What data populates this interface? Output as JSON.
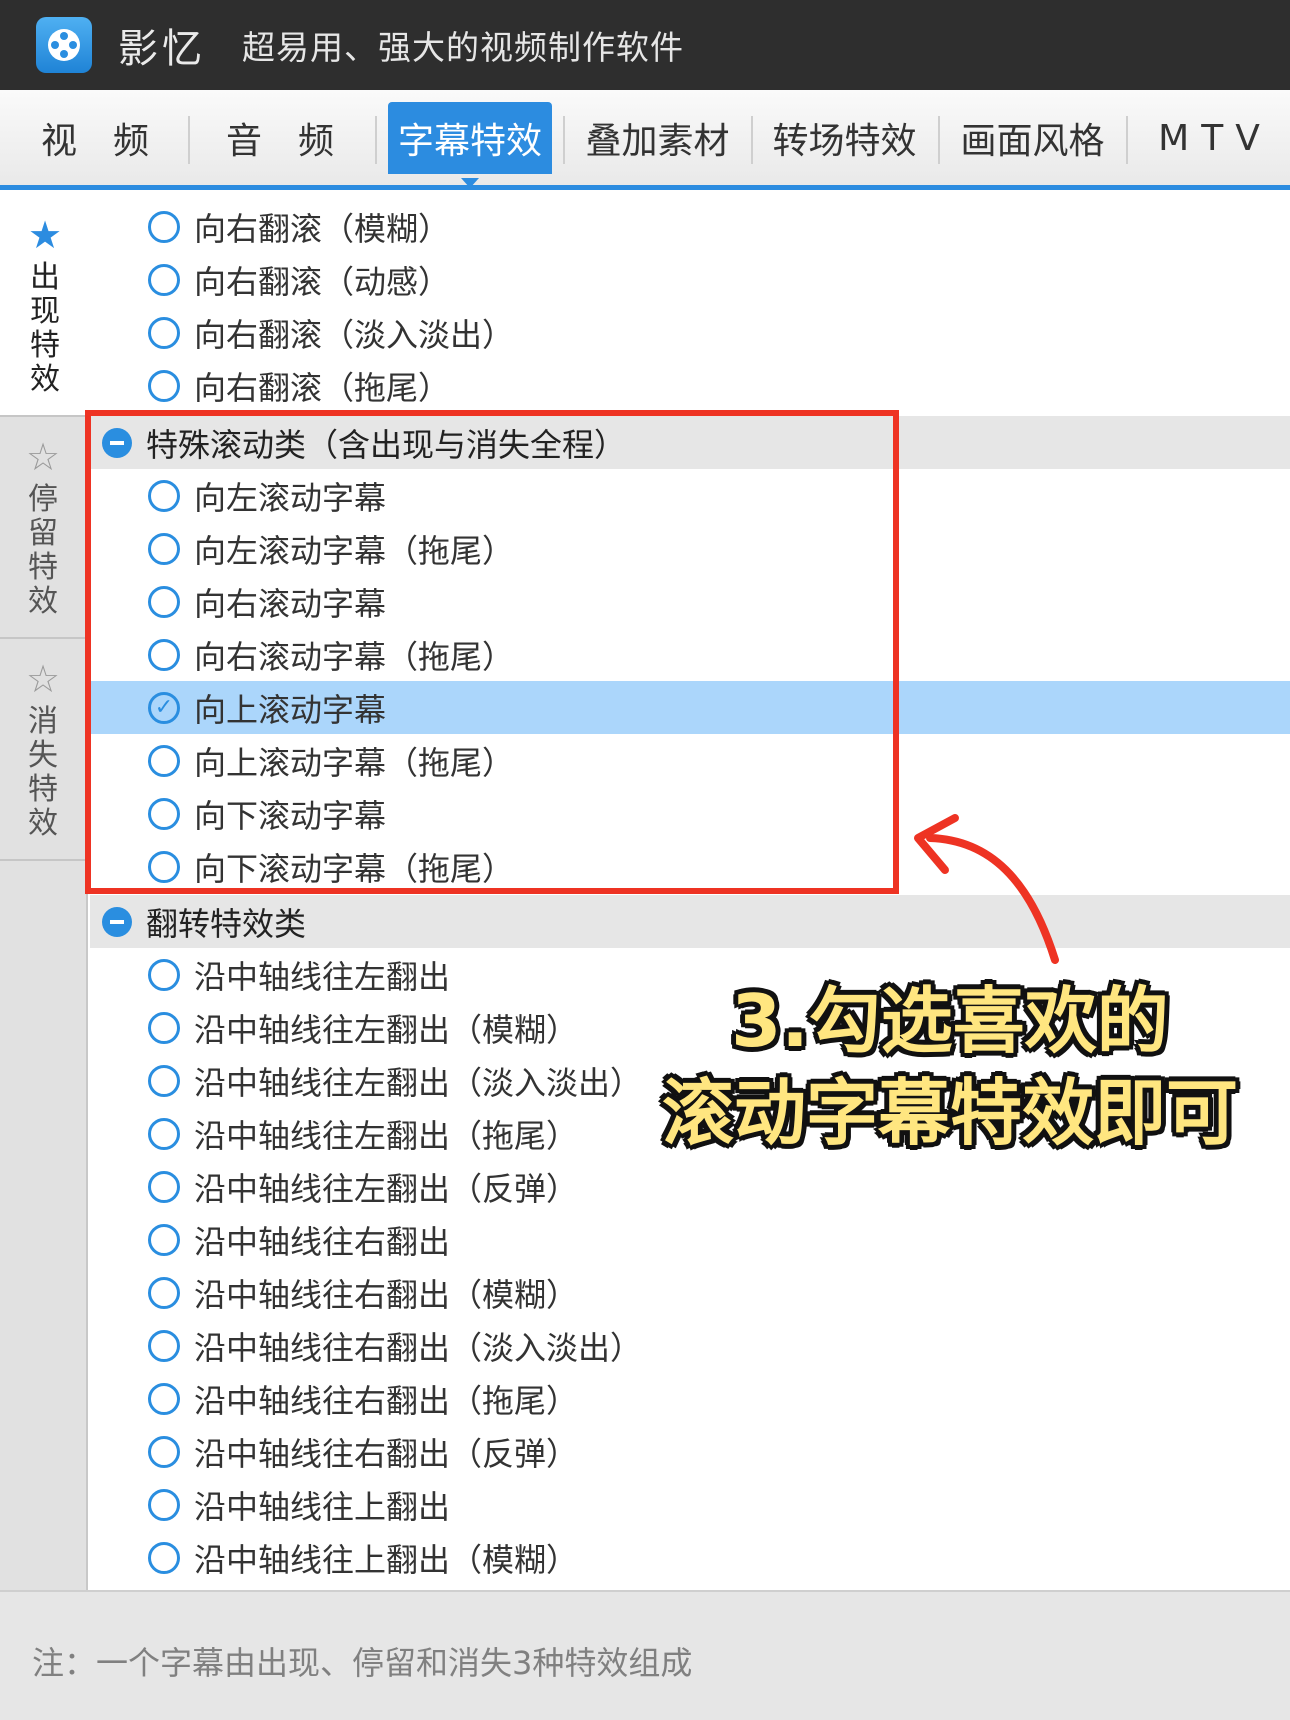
{
  "window": {
    "app_name": "影忆",
    "slogan": "超易用、强大的视频制作软件"
  },
  "tabs": [
    {
      "label": "视　频"
    },
    {
      "label": "音　频"
    },
    {
      "label": "字幕特效",
      "active": true
    },
    {
      "label": "叠加素材"
    },
    {
      "label": "转场特效"
    },
    {
      "label": "画面风格"
    },
    {
      "label": "MTV"
    }
  ],
  "side_tabs": [
    {
      "label": "出现特效",
      "active": true,
      "icon": "star-icon"
    },
    {
      "label": "停留特效",
      "icon": "star-outline-icon"
    },
    {
      "label": "消失特效",
      "icon": "star-exit-icon"
    }
  ],
  "list_items": [
    {
      "type": "item",
      "label": "向右翻滚（模糊）"
    },
    {
      "type": "item",
      "label": "向右翻滚（动感）"
    },
    {
      "type": "item",
      "label": "向右翻滚（淡入淡出）"
    },
    {
      "type": "item",
      "label": "向右翻滚（拖尾）"
    },
    {
      "type": "group",
      "label": "特殊滚动类（含出现与消失全程）"
    },
    {
      "type": "item",
      "label": "向左滚动字幕"
    },
    {
      "type": "item",
      "label": "向左滚动字幕（拖尾）"
    },
    {
      "type": "item",
      "label": "向右滚动字幕"
    },
    {
      "type": "item",
      "label": "向右滚动字幕（拖尾）"
    },
    {
      "type": "item",
      "label": "向上滚动字幕",
      "selected": true
    },
    {
      "type": "item",
      "label": "向上滚动字幕（拖尾）"
    },
    {
      "type": "item",
      "label": "向下滚动字幕"
    },
    {
      "type": "item",
      "label": "向下滚动字幕（拖尾）"
    },
    {
      "type": "group",
      "label": "翻转特效类"
    },
    {
      "type": "item",
      "label": "沿中轴线往左翻出"
    },
    {
      "type": "item",
      "label": "沿中轴线往左翻出（模糊）"
    },
    {
      "type": "item",
      "label": "沿中轴线往左翻出（淡入淡出）"
    },
    {
      "type": "item",
      "label": "沿中轴线往左翻出（拖尾）"
    },
    {
      "type": "item",
      "label": "沿中轴线往左翻出（反弹）"
    },
    {
      "type": "item",
      "label": "沿中轴线往右翻出"
    },
    {
      "type": "item",
      "label": "沿中轴线往右翻出（模糊）"
    },
    {
      "type": "item",
      "label": "沿中轴线往右翻出（淡入淡出）"
    },
    {
      "type": "item",
      "label": "沿中轴线往右翻出（拖尾）"
    },
    {
      "type": "item",
      "label": "沿中轴线往右翻出（反弹）"
    },
    {
      "type": "item",
      "label": "沿中轴线往上翻出"
    },
    {
      "type": "item",
      "label": "沿中轴线往上翻出（模糊）"
    }
  ],
  "footer": {
    "note": "注：一个字幕由出现、停留和消失3种特效组成"
  },
  "annotation": {
    "line1": "3.勾选喜欢的",
    "line2": "滚动字幕特效即可"
  },
  "colors": {
    "accent": "#2c8ce0",
    "selected_row": "#abd6fb",
    "highlight_box": "#ee3323",
    "callout_text": "#ffe680"
  }
}
